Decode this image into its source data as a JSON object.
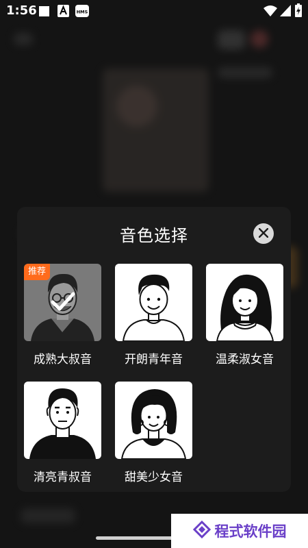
{
  "status_bar": {
    "time": "1:56",
    "icons": [
      "square-icon",
      "a-icon",
      "hms-icon",
      "wifi-icon",
      "signal-icon",
      "battery-charging-icon"
    ],
    "hms_label": "HMS"
  },
  "dialog": {
    "title": "音色选择",
    "close_icon": "close-icon",
    "voices": [
      {
        "label": "成熟大叔音",
        "badge": "推荐",
        "selected": true,
        "avatar": "mature-man-glasses-avatar"
      },
      {
        "label": "开朗青年音",
        "badge": null,
        "selected": false,
        "avatar": "cheerful-young-man-avatar"
      },
      {
        "label": "温柔淑女音",
        "badge": null,
        "selected": false,
        "avatar": "gentle-lady-avatar"
      },
      {
        "label": "清亮青叔音",
        "badge": null,
        "selected": false,
        "avatar": "clear-uncle-avatar"
      },
      {
        "label": "甜美少女音",
        "badge": null,
        "selected": false,
        "avatar": "sweet-girl-avatar"
      }
    ]
  },
  "watermark": {
    "text": "程式软件园",
    "accent": "#6a3fc8"
  },
  "colors": {
    "badge": "#ff6b1c",
    "dialog_bg": "#1c1c1c",
    "selected_thumb": "#7a7a7a"
  }
}
